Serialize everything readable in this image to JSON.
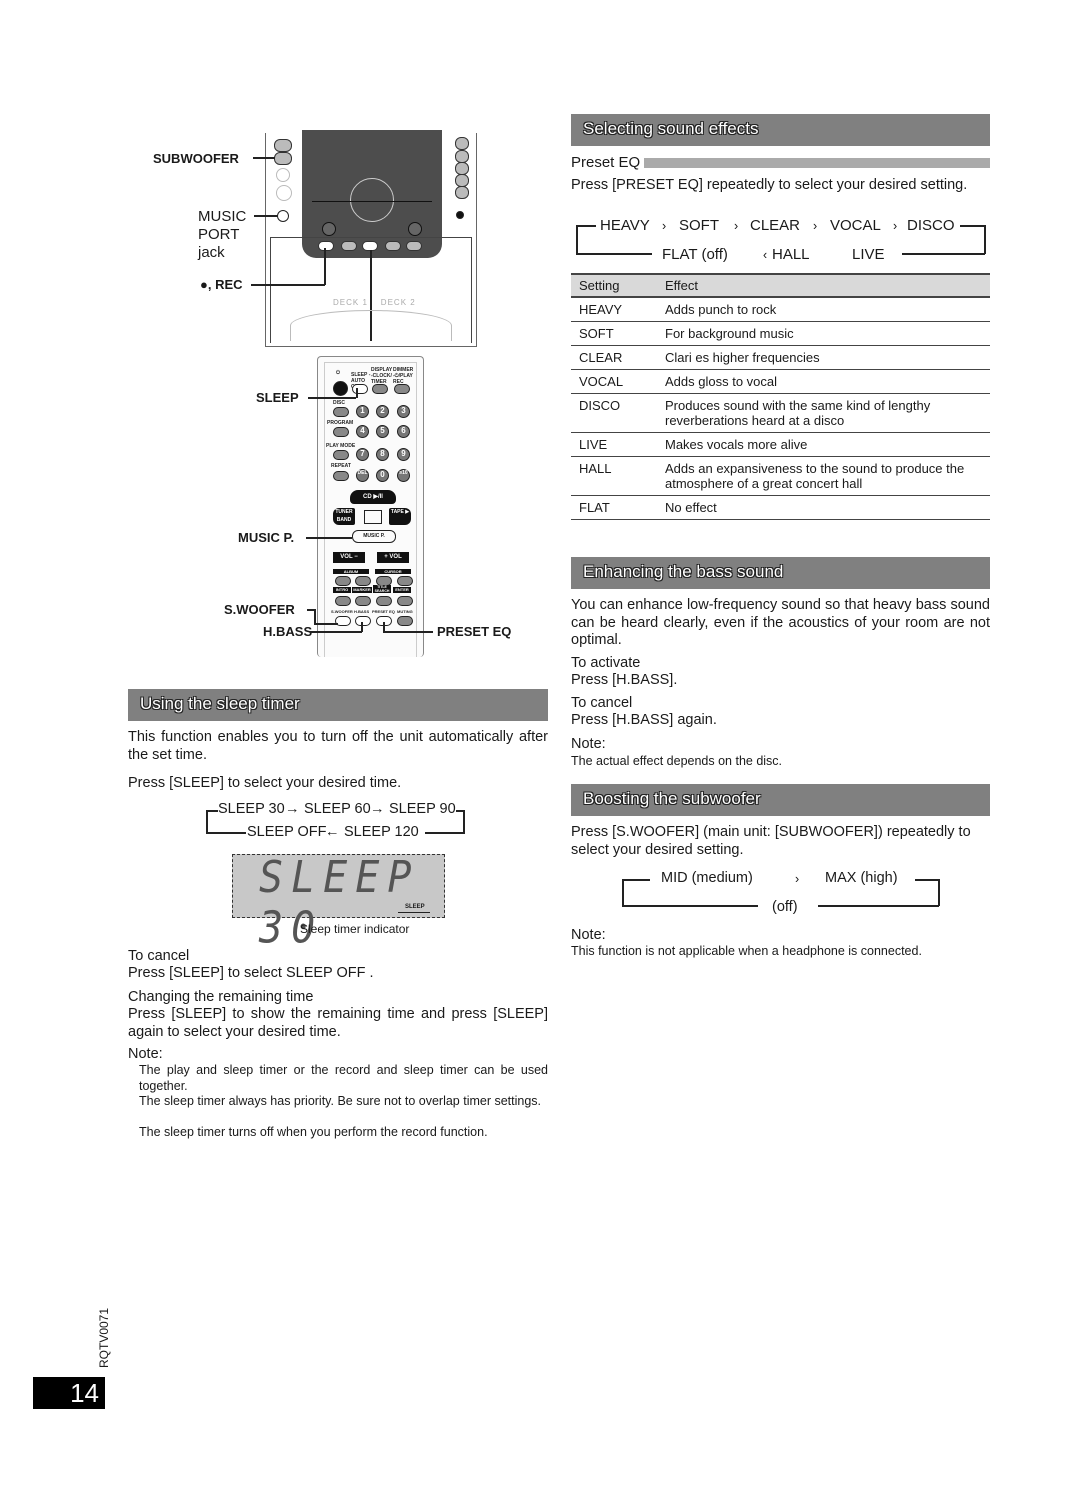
{
  "diagram_main_unit": {
    "labels": {
      "subwoofer": "SUBWOOFER",
      "music_port_line1": "MUSIC",
      "music_port_line2": "PORT",
      "music_port_line3": "jack",
      "rec": "●, REC"
    },
    "deck_labels": [
      "DECK 1",
      "DECK 2"
    ]
  },
  "diagram_remote": {
    "callouts": {
      "sleep": "SLEEP",
      "music_p": "MUSIC P.",
      "s_woofer": "S.WOOFER",
      "h_bass": "H.BASS",
      "preset_eq": "PRESET EQ"
    },
    "buttons": {
      "power": "⏻",
      "sleep": "SLEEP -AUTO OFF",
      "display": "DISPLAY -CLOCK/ TIMER",
      "dimmer": "DIMMER -⏻/PLAY REC",
      "disc": "DISC",
      "program": "PROGRAM",
      "play_mode": "PLAY MODE",
      "repeat": "REPEAT",
      "numbers": [
        "1",
        "2",
        "3",
        "4",
        "5",
        "6",
        "7",
        "8",
        "9",
        "DEL",
        "0",
        "≥10"
      ],
      "number_letters": [
        "",
        "ABC",
        "DEF",
        "GHI",
        "JKL",
        "MNO",
        "PQRS",
        "TUV",
        "WXYZ",
        "",
        "",
        "SPACE !\"#"
      ],
      "cd": "CD ▶/II",
      "tuner": "TUNER BAND",
      "tape": "TAPE ▶",
      "music_p": "MUSIC P.",
      "vol_minus": "VOL −",
      "vol_plus": "+ VOL",
      "album": "ALBUM",
      "cursor": "CURSOR",
      "intro": "INTRO",
      "marker": "MARKER",
      "title_search": "TITLE SEARCH",
      "enter": "ENTER",
      "s_woofer": "S.WOOFER",
      "h_bass": "H.BASS",
      "preset_eq": "PRESET EQ",
      "muting": "MUTING"
    }
  },
  "sleep_section": {
    "title": "Using the sleep timer",
    "intro": "This function enables you to turn off the unit automatically after the set time.",
    "instruction": "Press [SLEEP] to select your desired time.",
    "cycle_top": [
      "SLEEP 30",
      "SLEEP 60",
      "SLEEP 90"
    ],
    "cycle_bottom": [
      "SLEEP OFF",
      "SLEEP 120"
    ],
    "lcd_text": "SLEEP  30",
    "lcd_indicator": "SLEEP",
    "lcd_caption": "Sleep timer indicator",
    "cancel_heading": "To cancel",
    "cancel_text": "Press [SLEEP] to select  SLEEP OFF .",
    "change_heading": "Changing the remaining time",
    "change_text": "Press [SLEEP] to show the remaining time and press [SLEEP] again to select your desired time.",
    "note_label": "Note:",
    "notes": [
      "The play and sleep timer or the record and sleep timer can be used together.",
      "The sleep timer always has priority. Be sure not to overlap timer settings.",
      "The sleep timer turns off when you perform the record function."
    ]
  },
  "sound_effects_section": {
    "title": "Selecting sound effects",
    "subheading": "Preset EQ",
    "instruction": "Press [PRESET EQ] repeatedly to select your desired setting.",
    "cycle_top": [
      "HEAVY",
      "SOFT",
      "CLEAR",
      "VOCAL",
      "DISCO"
    ],
    "cycle_bottom": [
      "FLAT (off)",
      "HALL",
      "LIVE"
    ],
    "table_headers": [
      "Setting",
      "Effect"
    ],
    "table_rows": [
      {
        "setting": "HEAVY",
        "effect": "Adds punch to rock"
      },
      {
        "setting": "SOFT",
        "effect": "For background music"
      },
      {
        "setting": "CLEAR",
        "effect": "Clari es higher frequencies"
      },
      {
        "setting": "VOCAL",
        "effect": "Adds gloss to vocal"
      },
      {
        "setting": "DISCO",
        "effect": "Produces sound with the same kind of lengthy reverberations heard at a disco"
      },
      {
        "setting": "LIVE",
        "effect": "Makes vocals more alive"
      },
      {
        "setting": "HALL",
        "effect": "Adds an expansiveness to the sound to produce the atmosphere of a great concert hall"
      },
      {
        "setting": "FLAT",
        "effect": "No effect"
      }
    ]
  },
  "bass_section": {
    "title": "Enhancing the bass sound",
    "intro": "You can enhance low-frequency sound so that heavy bass sound can be heard clearly, even if the acoustics of your room are not optimal.",
    "activate_heading": "To activate",
    "activate_text": "Press  [H.BASS].",
    "cancel_heading": "To cancel",
    "cancel_text": "Press [H.BASS] again.",
    "note_label": "Note:",
    "note": "The actual effect depends on the disc."
  },
  "subwoofer_section": {
    "title": "Boosting the subwoofer",
    "instruction": "Press [S.WOOFER] (main unit: [SUBWOOFER]) repeatedly to select your desired setting.",
    "cycle_top": [
      "MID (medium)",
      "MAX (high)"
    ],
    "cycle_bottom": [
      "(off)"
    ],
    "note_label": "Note:",
    "note": "This function is not applicable when a headphone is connected."
  },
  "footer": {
    "doc_code": "RQTV0071",
    "page_number": "14"
  }
}
